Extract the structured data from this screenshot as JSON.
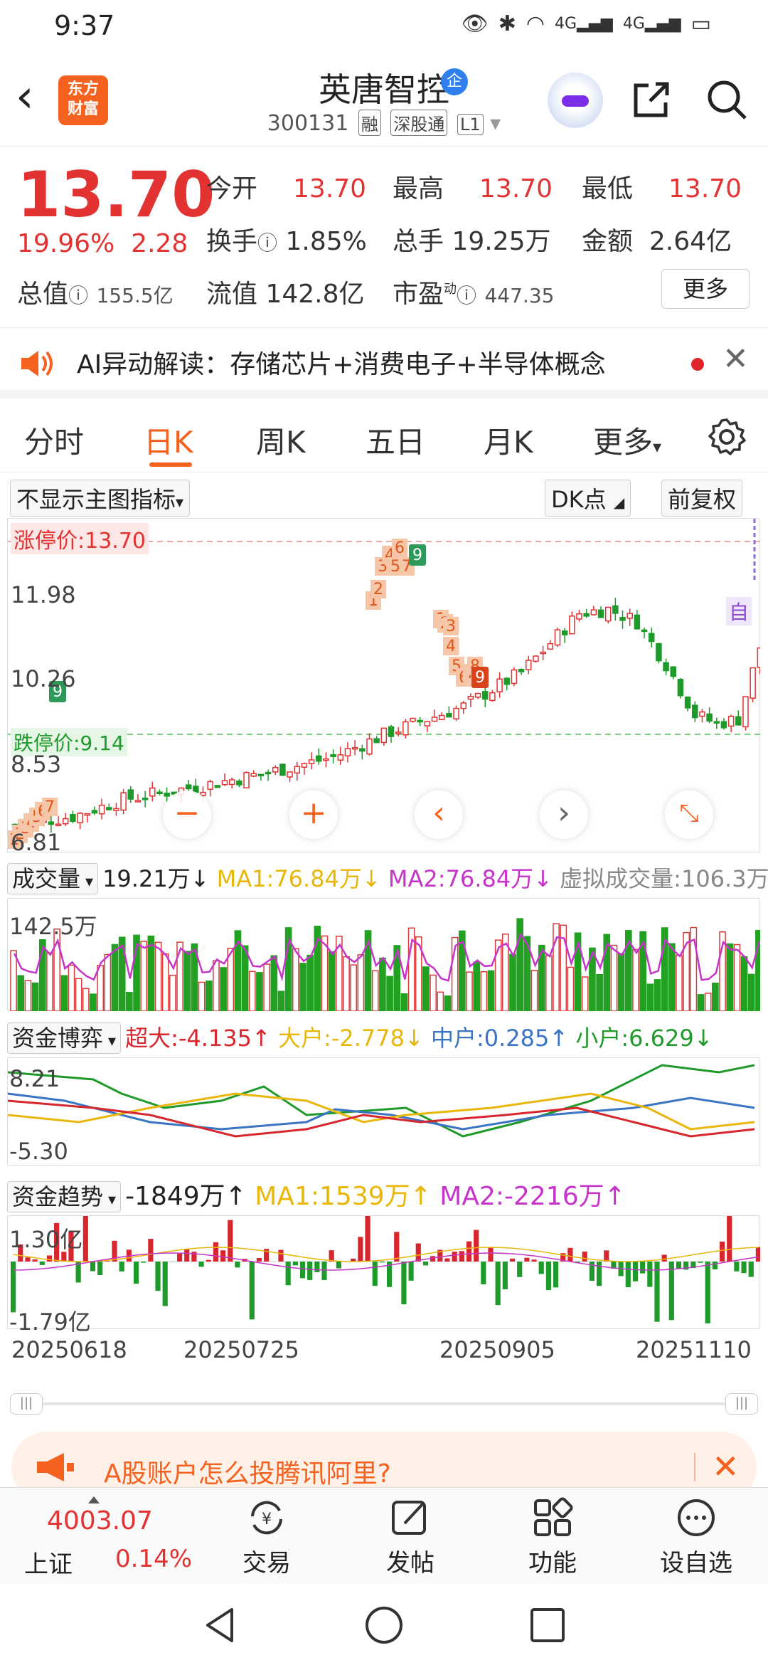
{
  "status": {
    "time": "9:37",
    "net1": "4G",
    "net2": "4G"
  },
  "header": {
    "logo_line1": "东方",
    "logo_line2": "财富",
    "name": "英唐智控",
    "badge": "企",
    "code": "300131",
    "tags": [
      "融",
      "深股通",
      "L1"
    ]
  },
  "quote": {
    "price": "13.70",
    "pct": "19.96%",
    "change": "2.28",
    "open_label": "今开",
    "open": "13.70",
    "high_label": "最高",
    "high": "13.70",
    "low_label": "最低",
    "low": "13.70",
    "turnover_label": "换手",
    "turnover": "1.85%",
    "volume_label": "总手",
    "volume": "19.25万",
    "amount_label": "金额",
    "amount": "2.64亿",
    "mktcap_label": "总值",
    "mktcap": "155.5亿",
    "float_label": "流值",
    "float": "142.8亿",
    "pe_label": "市盈",
    "pe_sup": "动",
    "pe": "447.35",
    "more": "更多"
  },
  "ai": {
    "text": "AI异动解读：存储芯片+消费电子+半导体概念"
  },
  "tabs": [
    "分时",
    "日K",
    "周K",
    "五日",
    "月K",
    "更多"
  ],
  "chart_toolbar": {
    "indicator": "不显示主图指标",
    "dk": "DK点",
    "adjust": "前复权"
  },
  "main_chart": {
    "limit_up_label": "涨停价:13.70",
    "limit_down_label": "跌停价:9.14",
    "y_labels": [
      "11.98",
      "10.26",
      "8.53",
      "6.81"
    ],
    "auto_label": "自"
  },
  "volume": {
    "label": "成交量",
    "value": "19.21万↓",
    "ma1": "MA1:76.84万↓",
    "ma2": "MA2:76.84万↓",
    "virtual": "虚拟成交量:106.3万",
    "ymax": "142.5万"
  },
  "fund_game": {
    "label": "资金博弈",
    "super": "超大:-4.135↑",
    "big": "大户:-2.778↓",
    "mid": "中户:0.285↑",
    "small": "小户:6.629↓",
    "ymax": "8.21",
    "ymin": "-5.30"
  },
  "fund_trend": {
    "label": "资金趋势",
    "value": "-1849万↑",
    "ma1": "MA1:1539万↑",
    "ma2": "MA2:-2216万↑",
    "ymax": "1.30亿",
    "ymin": "-1.79亿"
  },
  "dates": [
    "20250618",
    "20250725",
    "20250905",
    "20251110"
  ],
  "ad": {
    "text": "A股账户怎么投腾讯阿里?"
  },
  "bottom": {
    "index_value": "4003.07",
    "index_name": "上证",
    "index_pct": "0.14%",
    "items": [
      "交易",
      "发帖",
      "功能",
      "设自选"
    ]
  },
  "colors": {
    "up": "#e33232",
    "down": "#1e9a2a",
    "accent": "#f5611f"
  }
}
